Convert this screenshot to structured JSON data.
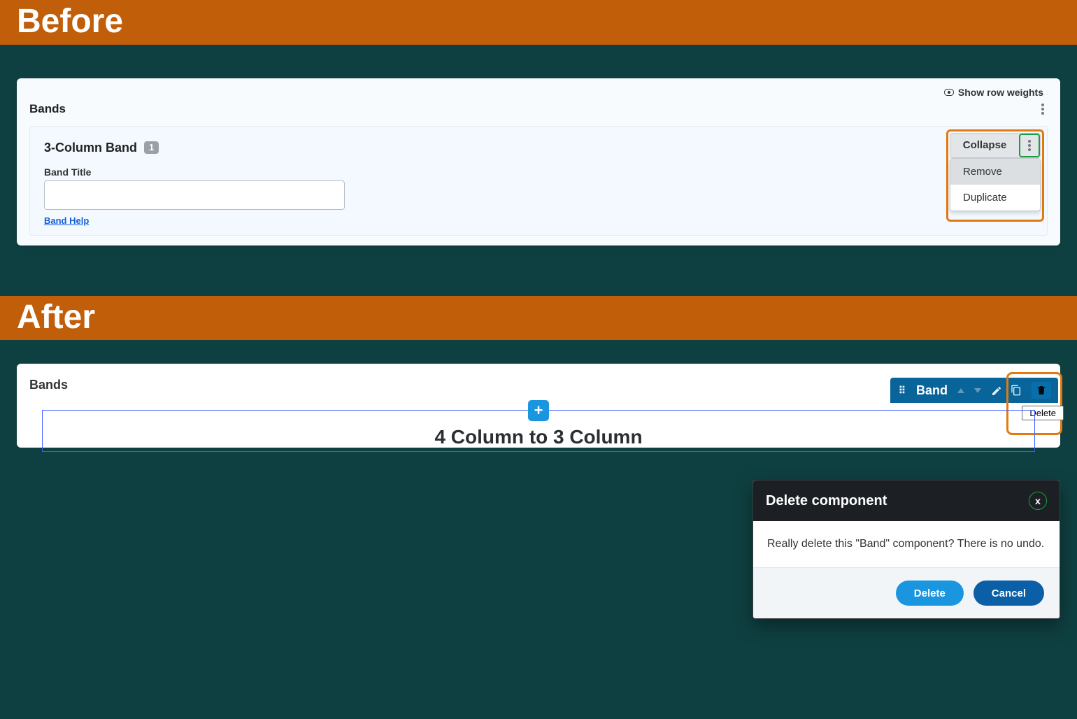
{
  "labels": {
    "before": "Before",
    "after": "After"
  },
  "before": {
    "row_weights": "Show row weights",
    "bands_heading": "Bands",
    "card_title": "3-Column Band",
    "index": "1",
    "field_label": "Band Title",
    "field_value": "",
    "help": "Band Help",
    "collapse": "Collapse",
    "menu": {
      "remove": "Remove",
      "duplicate": "Duplicate"
    }
  },
  "after": {
    "bands_heading": "Bands",
    "toolbar": {
      "name": "Band",
      "tooltip": "Delete"
    },
    "big_title": "4 Column to 3 Column",
    "plus": "+"
  },
  "dialog": {
    "title": "Delete component",
    "close": "x",
    "body": "Really delete this \"Band\" component? There is no undo.",
    "delete": "Delete",
    "cancel": "Cancel"
  }
}
